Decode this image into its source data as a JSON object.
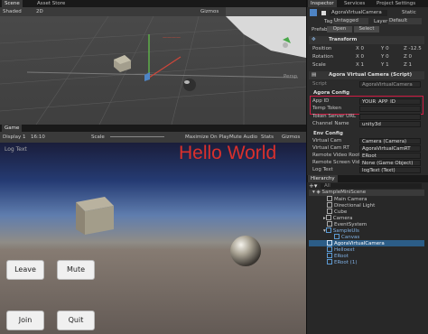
{
  "tabs_top": {
    "scene": "Scene",
    "asset_store": "Asset Store"
  },
  "scene_toolbar": {
    "shading": "Shaded",
    "mode": "2D",
    "gizmos": "Gizmos",
    "persp": "Persp"
  },
  "game_tab": {
    "label": "Game"
  },
  "game_toolbar": {
    "display": "Display 1",
    "aspect": "16:10",
    "scale": "Scale",
    "maximize": "Maximize On Play",
    "mute": "Mute Audio",
    "stats": "Stats",
    "gizmos": "Gizmos"
  },
  "game_view": {
    "log_text": "Log Text",
    "hello": "Hello World",
    "buttons": {
      "leave": "Leave",
      "mute": "Mute",
      "join": "Join",
      "quit": "Quit"
    }
  },
  "inspector_tabs": {
    "inspector": "Inspector",
    "services": "Services",
    "project_settings": "Project Settings"
  },
  "object": {
    "name": "AgoraVirtualCamera",
    "static": "Static",
    "tag_label": "Tag",
    "tag": "Untagged",
    "layer_label": "Layer",
    "layer": "Default",
    "prefab_label": "Prefab",
    "open": "Open",
    "select": "Select"
  },
  "transform": {
    "title": "Transform",
    "rows": [
      {
        "label": "Position",
        "x": "X 0",
        "y": "Y 0",
        "z": "Z -12.5"
      },
      {
        "label": "Rotation",
        "x": "X 0",
        "y": "Y 0",
        "z": "Z 0"
      },
      {
        "label": "Scale",
        "x": "X 1",
        "y": "Y 1",
        "z": "Z 1"
      }
    ]
  },
  "script": {
    "title": "Agora Virtual Camera (Script)",
    "script_label": "Script",
    "script_value": "AgoraVirtualCamera"
  },
  "agora_config": {
    "header": "Agora Config",
    "app_id_label": "App ID",
    "app_id": "YOUR_APP_ID",
    "temp_token_label": "Temp Token",
    "token_server_label": "Token Server URL",
    "channel_label": "Channel Name",
    "channel": "unity3d"
  },
  "env_config": {
    "header": "Env Config",
    "rows": [
      {
        "label": "Virtual Cam",
        "value": "Camera (Camera)"
      },
      {
        "label": "Virtual Cam RT",
        "value": "AgoraVirtualCamRT"
      },
      {
        "label": "Remote Video Root",
        "value": "ERoot"
      },
      {
        "label": "Remote Screen Video",
        "value": "None (Game Object)"
      },
      {
        "label": "Log Text",
        "value": "logText (Text)"
      }
    ]
  },
  "hierarchy": {
    "title": "Hierarchy",
    "search_placeholder": "All",
    "items": [
      {
        "label": "SampleMiniScene",
        "indent": 0
      },
      {
        "label": "Main Camera",
        "indent": 1
      },
      {
        "label": "Directional Light",
        "indent": 1
      },
      {
        "label": "Cube",
        "indent": 1
      },
      {
        "label": "Camera",
        "indent": 1
      },
      {
        "label": "EventSystem",
        "indent": 1
      },
      {
        "label": "SampleUIs",
        "indent": 1
      },
      {
        "label": "Canvas",
        "indent": 2
      },
      {
        "label": "AgoraVirtualCamera",
        "indent": 1
      },
      {
        "label": "Helloext",
        "indent": 1
      },
      {
        "label": "ERoot",
        "indent": 1
      },
      {
        "label": "ERoot (1)",
        "indent": 1
      }
    ]
  },
  "colors": {
    "selection": "#2c5d87",
    "hello": "#d9302c",
    "highlight_box": "#d01c44"
  }
}
